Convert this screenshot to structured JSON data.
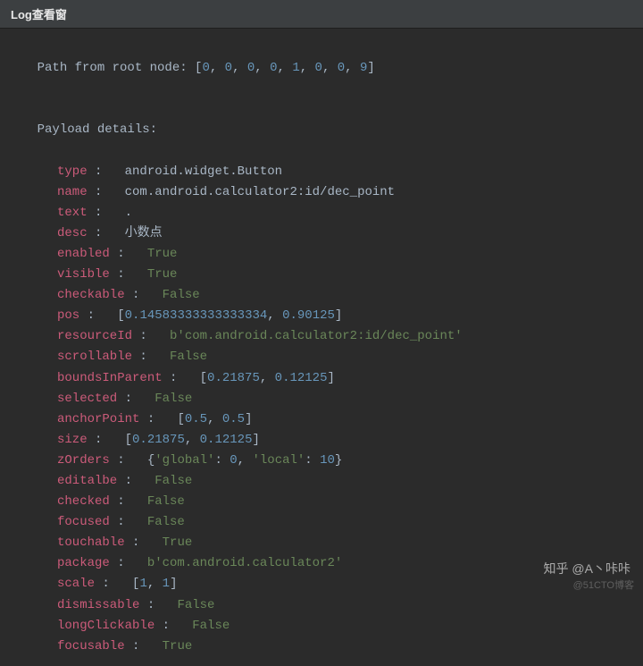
{
  "titlebar": {
    "title": "Log查看窗"
  },
  "prefix": {
    "path_label": "Path from root node: ",
    "payload_label": "Payload details:"
  },
  "path": [
    0,
    0,
    0,
    0,
    1,
    0,
    0,
    9
  ],
  "details": {
    "type": {
      "key": "type",
      "value": "android.widget.Button",
      "kind": "plain"
    },
    "name": {
      "key": "name",
      "value": "com.android.calculator2:id/dec_point",
      "kind": "plain"
    },
    "text": {
      "key": "text",
      "value": ".",
      "kind": "plain"
    },
    "desc": {
      "key": "desc",
      "value": "小数点",
      "kind": "plain"
    },
    "enabled": {
      "key": "enabled",
      "value": "True",
      "kind": "kw"
    },
    "visible": {
      "key": "visible",
      "value": "True",
      "kind": "kw"
    },
    "checkable": {
      "key": "checkable",
      "value": "False",
      "kind": "kw"
    },
    "pos": {
      "key": "pos",
      "value": [
        0.14583333333333334,
        0.90125
      ],
      "kind": "numlist"
    },
    "resourceId": {
      "key": "resourceId",
      "value": "b'com.android.calculator2:id/dec_point'",
      "kind": "str"
    },
    "scrollable": {
      "key": "scrollable",
      "value": "False",
      "kind": "kw"
    },
    "boundsInParent": {
      "key": "boundsInParent",
      "value": [
        0.21875,
        0.12125
      ],
      "kind": "numlist"
    },
    "selected": {
      "key": "selected",
      "value": "False",
      "kind": "kw"
    },
    "anchorPoint": {
      "key": "anchorPoint",
      "value": [
        0.5,
        0.5
      ],
      "kind": "numlist"
    },
    "size": {
      "key": "size",
      "value": [
        0.21875,
        0.12125
      ],
      "kind": "numlist"
    },
    "zOrders": {
      "key": "zOrders",
      "global_label": "'global'",
      "global_val": 0,
      "local_label": "'local'",
      "local_val": 10,
      "kind": "dict"
    },
    "editalbe": {
      "key": "editalbe",
      "value": "False",
      "kind": "kw"
    },
    "checked": {
      "key": "checked",
      "value": "False",
      "kind": "kw"
    },
    "focused": {
      "key": "focused",
      "value": "False",
      "kind": "kw"
    },
    "touchable": {
      "key": "touchable",
      "value": "True",
      "kind": "kw"
    },
    "package": {
      "key": "package",
      "value": "b'com.android.calculator2'",
      "kind": "str"
    },
    "scale": {
      "key": "scale",
      "value": [
        1,
        1
      ],
      "kind": "numlist"
    },
    "dismissable": {
      "key": "dismissable",
      "value": "False",
      "kind": "kw"
    },
    "longClickable": {
      "key": "longClickable",
      "value": "False",
      "kind": "kw"
    },
    "focusable": {
      "key": "focusable",
      "value": "True",
      "kind": "kw"
    }
  },
  "order": [
    "type",
    "name",
    "text",
    "desc",
    "enabled",
    "visible",
    "checkable",
    "pos",
    "resourceId",
    "scrollable",
    "boundsInParent",
    "selected",
    "anchorPoint",
    "size",
    "zOrders",
    "editalbe",
    "checked",
    "focused",
    "touchable",
    "package",
    "scale",
    "dismissable",
    "longClickable",
    "focusable"
  ],
  "watermark": "知乎 @A丶咔咔",
  "watermark2": "@51CTO博客"
}
